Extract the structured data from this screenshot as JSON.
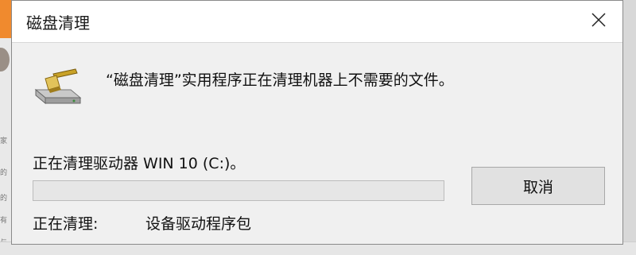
{
  "dialog": {
    "title": "磁盘清理",
    "close_icon": "close-icon",
    "app_icon": "disk-cleanup-icon",
    "message": "“磁盘清理”实用程序正在清理机器上不需要的文件。",
    "drive_status": "正在清理驱动器 WIN 10 (C:)。",
    "progress_fraction": 0.0,
    "cleaning_label": "正在清理:",
    "cleaning_item": "设备驱动程序包",
    "cancel_label": "取消"
  },
  "background": {
    "fragments": [
      "家",
      "的",
      "的",
      "有",
      "与"
    ]
  },
  "colors": {
    "progress_fill": "#06b025",
    "dialog_bg": "#f0f0f0",
    "titlebar_bg": "#ffffff"
  }
}
